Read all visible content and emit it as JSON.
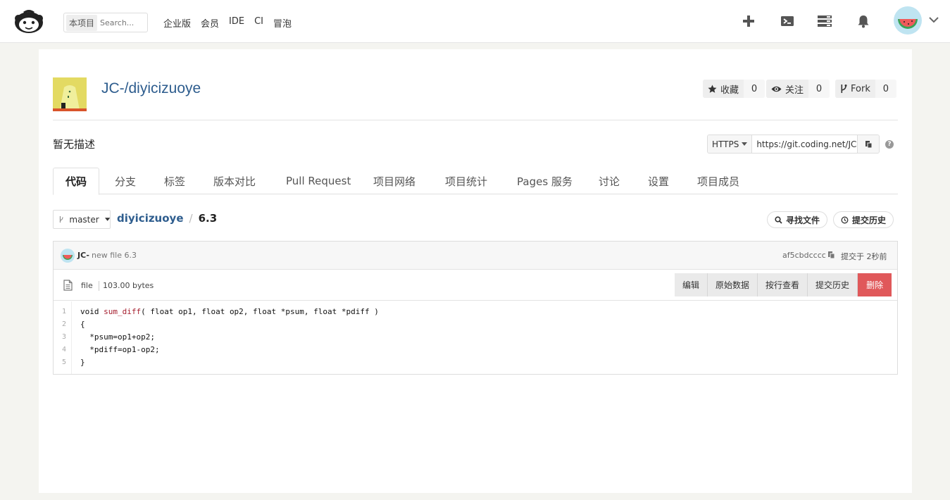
{
  "header": {
    "search_scope": "本项目",
    "search_placeholder": "Search...",
    "nav": [
      "企业版",
      "会员",
      "IDE",
      "CI",
      "冒泡"
    ],
    "icons": [
      "plus-icon",
      "terminal-icon",
      "server-icon",
      "bell-icon"
    ]
  },
  "project": {
    "title": "JC-/diyicizuoye",
    "stats": [
      {
        "label": "收藏",
        "count": "0",
        "icon": "star-icon"
      },
      {
        "label": "关注",
        "count": "0",
        "icon": "eye-icon"
      },
      {
        "label": "Fork",
        "count": "0",
        "icon": "fork-icon"
      }
    ],
    "description": "暂无描述",
    "clone_protocol": "HTTPS",
    "clone_url": "https://git.coding.net/JC-/diyicizuoye.git"
  },
  "tabs": [
    "代码",
    "分支",
    "标签",
    "版本对比",
    "Pull Request",
    "项目网络",
    "项目统计",
    "Pages 服务",
    "讨论",
    "设置",
    "项目成员"
  ],
  "repo": {
    "branch": "master",
    "repo_name": "diyicizuoye",
    "separator": "/",
    "file_name": "6.3",
    "find_file": "寻找文件",
    "history": "提交历史"
  },
  "commit": {
    "author": "JC-",
    "message": "new file 6.3",
    "hash": "af5cbdcccc",
    "time": "提交于 2秒前"
  },
  "file": {
    "type": "file",
    "size": "103.00 bytes",
    "buttons": [
      "编辑",
      "原始数据",
      "按行查看",
      "提交历史"
    ],
    "delete": "删除"
  },
  "code": {
    "line_numbers": [
      "1",
      "2",
      "3",
      "4",
      "5"
    ],
    "l1_kw": "void ",
    "l1_fn": "sum_diff",
    "l1_rest": "( float op1, float op2, float *psum, float *pdiff )",
    "l2": "{",
    "l3": "  *psum=op1+op2;",
    "l4": "  *pdiff=op1-op2;",
    "l5": "}"
  }
}
